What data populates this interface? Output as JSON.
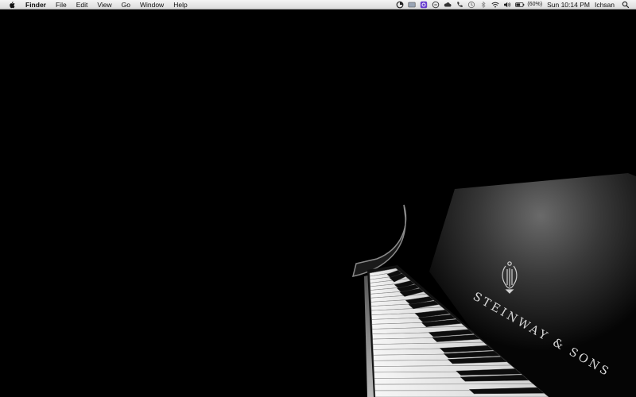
{
  "menubar": {
    "app_name": "Finder",
    "menus": [
      "File",
      "Edit",
      "View",
      "Go",
      "Window",
      "Help"
    ],
    "status": {
      "battery_percent": "(60%)",
      "clock": "Sun 10:14 PM",
      "user": "Ichsan"
    },
    "tray_icons": [
      "screen-recorder-icon",
      "display-icon",
      "app-status-icon",
      "time-icon",
      "cloud-icon",
      "phone-icon",
      "time-machine-icon",
      "bluetooth-icon",
      "wifi-icon",
      "volume-icon",
      "battery-icon",
      "search-icon"
    ]
  },
  "wallpaper": {
    "brand_text": "STEINWAY & SONS",
    "subject": "grand-piano"
  }
}
